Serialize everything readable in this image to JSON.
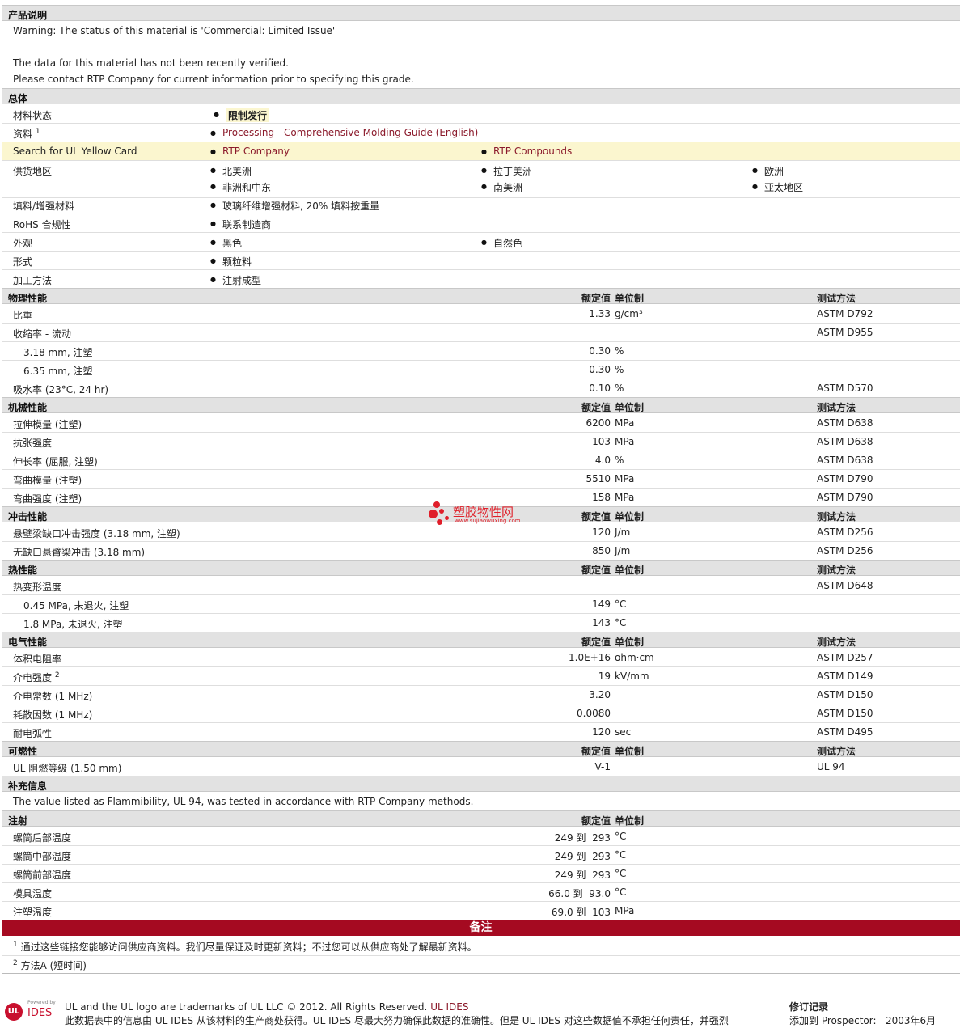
{
  "product": {
    "title": "产品说明",
    "warning": "Warning: The status of this material is 'Commercial: Limited Issue'",
    "note1": "The data for this material has not been recently verified.",
    "note2": "Please contact RTP Company for current information prior to specifying this grade."
  },
  "general": {
    "title": "总体",
    "status_label": "材料状态",
    "status_value": "限制发行",
    "source_label": "资料",
    "source_sup": "1",
    "source_link": "Processing - Comprehensive Molding Guide (English)",
    "ul_label": "Search for UL Yellow Card",
    "ul_link1": "RTP Company",
    "ul_link2": "RTP Compounds",
    "supply_label": "供货地区",
    "supply": [
      "北美洲",
      "拉丁美洲",
      "欧洲",
      "非洲和中东",
      "南美洲",
      "亚太地区"
    ],
    "filler_label": "填料/增强材料",
    "filler_value": "玻璃纤维增强材料, 20% 填料按重量",
    "rohs_label": "RoHS 合规性",
    "rohs_value": "联系制造商",
    "appearance_label": "外观",
    "appearance": [
      "黑色",
      "自然色"
    ],
    "form_label": "形式",
    "form_value": "颗粒料",
    "process_label": "加工方法",
    "process_value": "注射成型"
  },
  "headers": {
    "value": "额定值",
    "unit": "单位制",
    "method": "测试方法"
  },
  "physical": {
    "title": "物理性能",
    "rows": [
      {
        "label": "比重",
        "value": "1.33",
        "unit": "g/cm³",
        "method": "ASTM D792"
      },
      {
        "label": "收缩率 - 流动",
        "value": "",
        "unit": "",
        "method": "ASTM D955"
      },
      {
        "label": "3.18 mm, 注塑",
        "value": "0.30",
        "unit": "%",
        "method": ""
      },
      {
        "label": "6.35 mm, 注塑",
        "value": "0.30",
        "unit": "%",
        "method": ""
      },
      {
        "label": "吸水率 (23°C, 24 hr)",
        "value": "0.10",
        "unit": "%",
        "method": "ASTM D570"
      }
    ]
  },
  "mechanical": {
    "title": "机械性能",
    "rows": [
      {
        "label": "拉伸模量 (注塑)",
        "value": "6200",
        "unit": "MPa",
        "method": "ASTM D638"
      },
      {
        "label": "抗张强度",
        "value": "103",
        "unit": "MPa",
        "method": "ASTM D638"
      },
      {
        "label": "伸长率 (屈服, 注塑)",
        "value": "4.0",
        "unit": "%",
        "method": "ASTM D638"
      },
      {
        "label": "弯曲模量 (注塑)",
        "value": "5510",
        "unit": "MPa",
        "method": "ASTM D790"
      },
      {
        "label": "弯曲强度 (注塑)",
        "value": "158",
        "unit": "MPa",
        "method": "ASTM D790"
      }
    ]
  },
  "impact": {
    "title": "冲击性能",
    "rows": [
      {
        "label": "悬壁梁缺口冲击强度 (3.18 mm, 注塑)",
        "value": "120",
        "unit": "J/m",
        "method": "ASTM D256"
      },
      {
        "label": "无缺口悬臂梁冲击 (3.18 mm)",
        "value": "850",
        "unit": "J/m",
        "method": "ASTM D256"
      }
    ]
  },
  "thermal": {
    "title": "热性能",
    "rows": [
      {
        "label": "热变形温度",
        "value": "",
        "unit": "",
        "method": "ASTM D648"
      },
      {
        "label": "0.45 MPa, 未退火, 注塑",
        "value": "149",
        "unit": "°C",
        "method": ""
      },
      {
        "label": "1.8 MPa, 未退火, 注塑",
        "value": "143",
        "unit": "°C",
        "method": ""
      }
    ]
  },
  "electrical": {
    "title": "电气性能",
    "rows": [
      {
        "label": "体积电阻率",
        "value": "1.0E+16",
        "unit": "ohm·cm",
        "method": "ASTM D257"
      },
      {
        "label": "介电强度",
        "sup": "2",
        "value": "19",
        "unit": "kV/mm",
        "method": "ASTM D149"
      },
      {
        "label": "介电常数 (1 MHz)",
        "value": "3.20",
        "unit": "",
        "method": "ASTM D150"
      },
      {
        "label": "耗散因数 (1 MHz)",
        "value": "0.0080",
        "unit": "",
        "method": "ASTM D150"
      },
      {
        "label": "耐电弧性",
        "value": "120",
        "unit": "sec",
        "method": "ASTM D495"
      }
    ]
  },
  "flammability": {
    "title": "可燃性",
    "rows": [
      {
        "label": "UL 阻燃等级 (1.50 mm)",
        "value": "V-1",
        "unit": "",
        "method": "UL 94"
      }
    ]
  },
  "supplement": {
    "title": "补充信息",
    "text": "The value listed as Flammibility, UL 94, was tested in accordance with RTP Company methods."
  },
  "injection": {
    "title": "注射",
    "rows": [
      {
        "label": "螺筒后部温度",
        "value": "249 到  293",
        "unit": "°C"
      },
      {
        "label": "螺筒中部温度",
        "value": "249 到  293",
        "unit": "°C"
      },
      {
        "label": "螺筒前部温度",
        "value": "249 到  293",
        "unit": "°C"
      },
      {
        "label": "模具温度",
        "value": "66.0 到  93.0",
        "unit": "°C"
      },
      {
        "label": "注塑温度",
        "value": "69.0 到  103",
        "unit": "MPa"
      }
    ]
  },
  "notes": {
    "title": "备注",
    "n1_sup": "1",
    "n1": "通过这些链接您能够访问供应商资料。我们尽量保证及时更新资料；不过您可以从供应商处了解最新资料。",
    "n2_sup": "2",
    "n2": "方法A (短时间)"
  },
  "watermark": {
    "cn": "塑胶物性网",
    "url": "www.sujiaowuxing.com"
  },
  "footer": {
    "logo_ul": "UL",
    "logo_ides": "IDES",
    "powered": "Powered by",
    "line1": "UL and the UL logo are trademarks of UL LLC © 2012. All Rights Reserved.",
    "line1_link": "UL IDES",
    "line2": "此数据表中的信息由  UL IDES 从该材料的生产商处获得。UL IDES 尽最大努力确保此数据的准确性。但是  UL IDES 对这些数据值不承担任何责任，并强烈",
    "rev_title": "修订记录",
    "rev_label": "添加到  Prospector:",
    "rev_date": "2003年6月"
  }
}
